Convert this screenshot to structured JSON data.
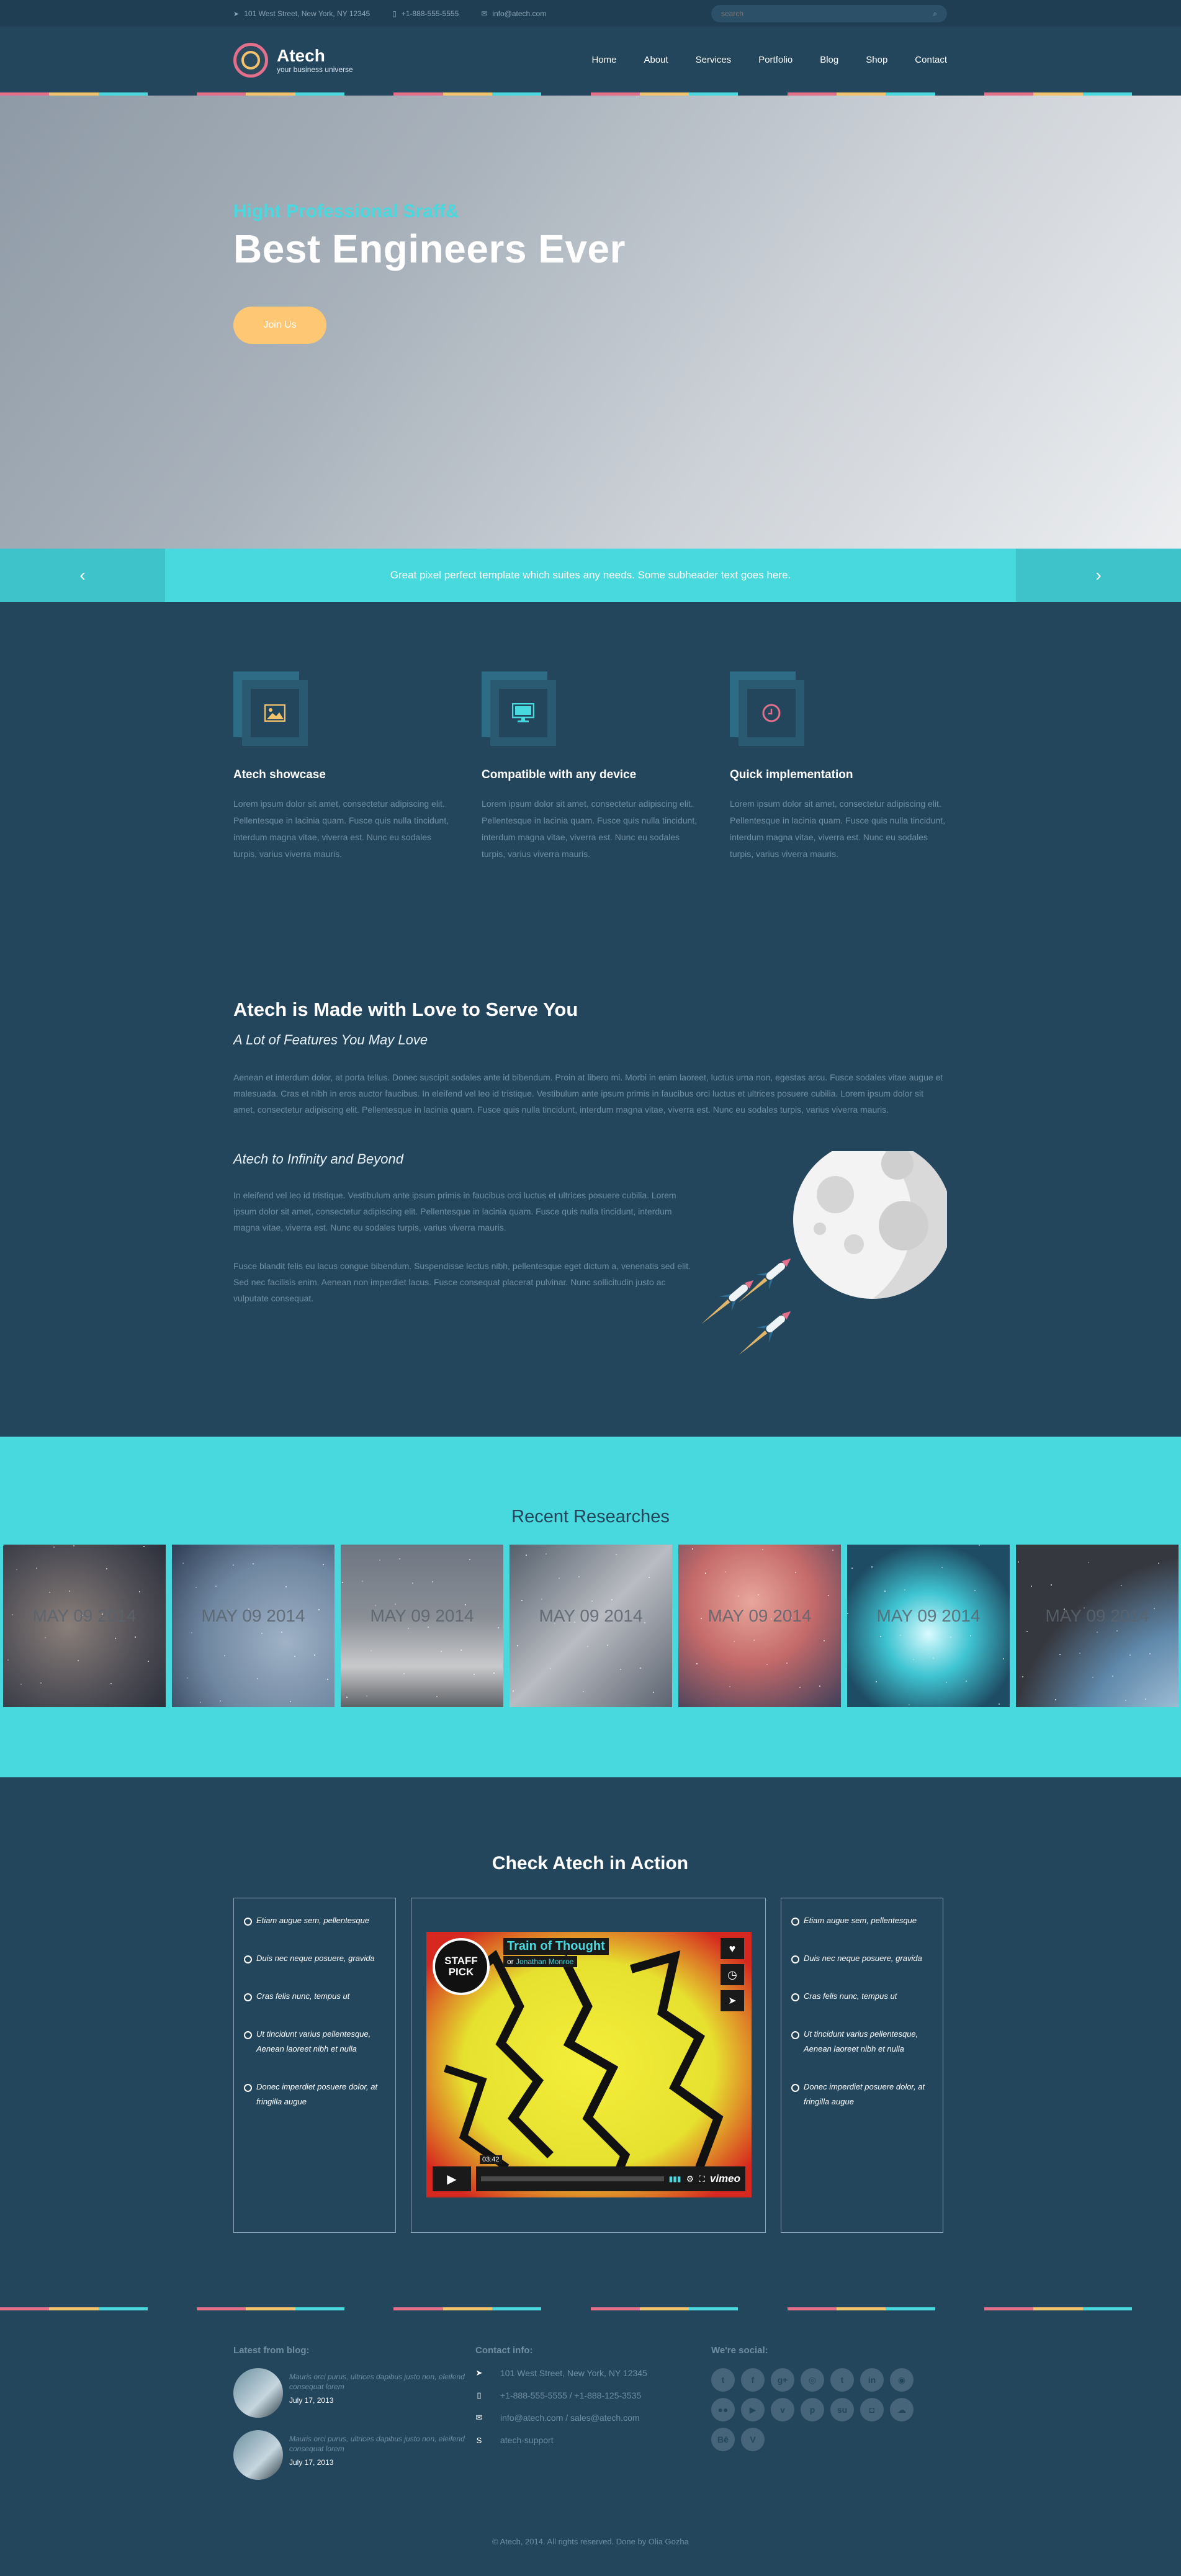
{
  "topbar": {
    "address": "101 West Street, New York, NY 12345",
    "phone": "+1-888-555-5555",
    "email": "info@atech.com",
    "search_placeholder": "search"
  },
  "header": {
    "logo_name": "Atech",
    "logo_tagline": "your business universe",
    "nav": [
      "Home",
      "About",
      "Services",
      "Portfolio",
      "Blog",
      "Shop",
      "Contact"
    ]
  },
  "stripe_colors": [
    "#e36f8a",
    "#f4c26b",
    "#47d9de",
    "#23465d"
  ],
  "hero": {
    "kicker": "Hight Professional Sraff&",
    "title": "Best Engineers Ever",
    "button": "Join Us"
  },
  "subheader": {
    "text": "Great pixel perfect template which suites any needs. Some subheader text goes here.",
    "prev": "‹",
    "next": "›"
  },
  "features": [
    {
      "icon": "image-icon",
      "title": "Atech showcase",
      "text": "Lorem ipsum dolor sit amet, consectetur adipiscing elit. Pellentesque in lacinia quam. Fusce quis nulla tincidunt, interdum magna vitae, viverra est. Nunc eu sodales turpis, varius viverra mauris."
    },
    {
      "icon": "monitor-icon",
      "title": "Compatible with any device",
      "text": "Lorem ipsum dolor sit amet, consectetur adipiscing elit. Pellentesque in lacinia quam. Fusce quis nulla tincidunt, interdum magna vitae, viverra est. Nunc eu sodales turpis, varius viverra mauris."
    },
    {
      "icon": "clock-icon",
      "title": "Quick implementation",
      "text": "Lorem ipsum dolor sit amet, consectetur adipiscing elit. Pellentesque in lacinia quam. Fusce quis nulla tincidunt, interdum magna vitae, viverra est. Nunc eu sodales turpis, varius viverra mauris."
    }
  ],
  "love": {
    "title": "Atech is Made with Love to Serve You",
    "subtitle": "A Lot of Features You May Love",
    "para": "Aenean et interdum dolor, at porta tellus. Donec suscipit sodales ante id bibendum. Proin at libero mi. Morbi in enim laoreet, luctus urna non, egestas arcu. Fusce sodales vitae augue et malesuada. Cras et nibh in eros auctor faucibus. In eleifend vel leo id tristique. Vestibulum ante ipsum primis in faucibus orci luctus et ultrices posuere cubilia. Lorem ipsum dolor sit amet, consectetur adipiscing elit. Pellentesque in lacinia quam. Fusce quis nulla tincidunt, interdum magna vitae, viverra est. Nunc eu sodales turpis, varius viverra mauris.",
    "subtitle2": "Atech to Infinity and Beyond",
    "para2": "In eleifend vel leo id tristique. Vestibulum ante ipsum primis in faucibus orci luctus et ultrices posuere cubilia. Lorem ipsum dolor sit amet, consectetur adipiscing elit. Pellentesque in lacinia quam. Fusce quis nulla tincidunt, interdum magna vitae, viverra est. Nunc eu sodales turpis, varius viverra mauris.",
    "para3": "Fusce blandit felis eu lacus congue bibendum. Suspendisse lectus nibh, pellentesque eget dictum a, venenatis sed elit. Sed nec facilisis enim. Aenean non imperdiet lacus. Fusce consequat placerat pulvinar. Nunc sollicitudin justo ac vulputate consequat."
  },
  "research": {
    "title": "Recent Researches",
    "items": [
      {
        "date": "MAY 09 2014",
        "bg": "radial-gradient(circle at 40% 50%, #8a7f7a, #4e4d55 60%, #2b2f3a)"
      },
      {
        "date": "MAY 09 2014",
        "bg": "radial-gradient(circle at 70% 60%, #9fb2c6, #6f86a0 55%, #2f3d55)"
      },
      {
        "date": "MAY 09 2014",
        "bg": "linear-gradient(180deg, #6e7682 0%, #8a8f96 45%, #c8c9cb 75%, #5e6166 100%)"
      },
      {
        "date": "MAY 09 2014",
        "bg": "linear-gradient(135deg, #56606c, #b9bcc2 50%, #5d6470)"
      },
      {
        "date": "MAY 09 2014",
        "bg": "radial-gradient(circle at 45% 35%, #e8a69b, #c46a6a 45%, #3e3f5a)"
      },
      {
        "date": "MAY 09 2014",
        "bg": "radial-gradient(circle at 50% 55%, #d9fbff, #3fc4d2 35%, #1e4c64 75%)"
      },
      {
        "date": "MAY 09 2014",
        "bg": "radial-gradient(circle at 120% 130%, #cfe6f6, #5f88aa 45%, #36383f 70%)"
      }
    ]
  },
  "action": {
    "title": "Check Atech in Action",
    "list": [
      "Etiam augue sem, pellentesque",
      "Duis nec neque posuere, gravida",
      "Cras felis nunc, tempus ut",
      "Ut tincidunt varius pellentesque, Aenean laoreet nibh et nulla",
      "Donec imperdiet posuere dolor, at fringilla augue"
    ],
    "video": {
      "badge": "STAFF PICK",
      "title": "Train of Thought",
      "byline_prefix": "or",
      "byline_author": "Jonathan Monroe",
      "time": "03:42",
      "brand": "vimeo"
    }
  },
  "footer": {
    "blog_title": "Latest from blog:",
    "posts": [
      {
        "text": "Mauris orci purus, ultrices dapibus justo non, eleifend consequat lorem",
        "date": "July 17, 2013"
      },
      {
        "text": "Mauris orci purus, ultrices dapibus justo non, eleifend consequat lorem",
        "date": "July 17, 2013"
      }
    ],
    "contact_title": "Contact info:",
    "contact": [
      {
        "icon": "location-icon",
        "glyph": "➤",
        "text": "101 West Street, New York, NY 12345"
      },
      {
        "icon": "phone-icon",
        "glyph": "▯",
        "text": "+1-888-555-5555 / +1-888-125-3535"
      },
      {
        "icon": "mail-icon",
        "glyph": "✉",
        "text": "info@atech.com / sales@atech.com"
      },
      {
        "icon": "skype-icon",
        "glyph": "S",
        "text": "atech-support"
      }
    ],
    "social_title": "We're social:",
    "socials": [
      {
        "name": "twitter-icon",
        "glyph": "t"
      },
      {
        "name": "facebook-icon",
        "glyph": "f"
      },
      {
        "name": "googleplus-icon",
        "glyph": "g+"
      },
      {
        "name": "dribbble-icon",
        "glyph": "◎"
      },
      {
        "name": "tumblr-icon",
        "glyph": "t"
      },
      {
        "name": "linkedin-icon",
        "glyph": "in"
      },
      {
        "name": "github-icon",
        "glyph": "◉"
      },
      {
        "name": "flickr-icon",
        "glyph": "●●"
      },
      {
        "name": "youtube-icon",
        "glyph": "▶"
      },
      {
        "name": "vimeo-icon",
        "glyph": "v"
      },
      {
        "name": "pinterest-icon",
        "glyph": "p"
      },
      {
        "name": "stumbleupon-icon",
        "glyph": "su"
      },
      {
        "name": "instagram-icon",
        "glyph": "◘"
      },
      {
        "name": "soundcloud-icon",
        "glyph": "☁"
      },
      {
        "name": "behance-icon",
        "glyph": "Bē"
      },
      {
        "name": "vine-icon",
        "glyph": "V"
      }
    ],
    "copyright": "© Atech, 2014. All rights reserved. Done by Olia Gozha"
  }
}
